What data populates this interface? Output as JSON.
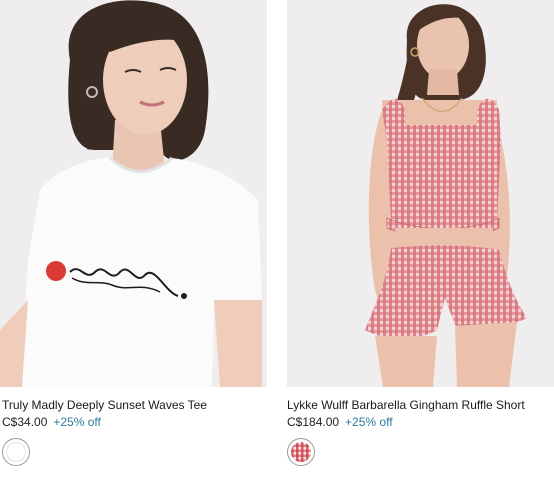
{
  "products": [
    {
      "title": "Truly Madly Deeply Sunset Waves Tee",
      "price": "C$34.00",
      "discount": "+25% off",
      "swatch": {
        "name": "white",
        "color": "#ffffff"
      }
    },
    {
      "title": "Lykke Wulff Barbarella Gingham Ruffle Short",
      "price": "C$184.00",
      "discount": "+25% off",
      "swatch": {
        "name": "red gingham",
        "color": "#c9343e"
      }
    }
  ],
  "colors": {
    "discount": "#2b7a9e",
    "background": "#ffffff"
  }
}
